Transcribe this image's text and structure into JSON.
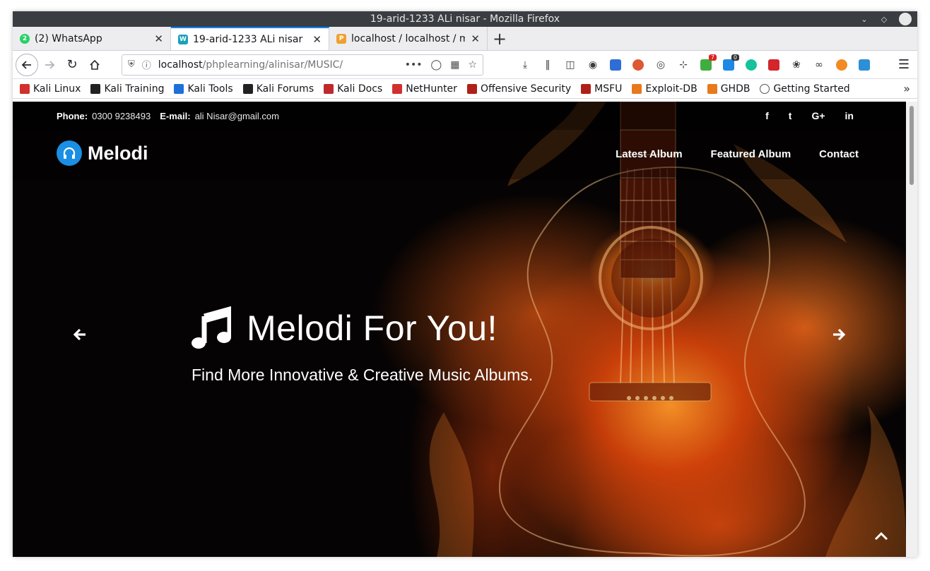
{
  "window": {
    "title": "19-arid-1233 ALi nisar - Mozilla Firefox"
  },
  "tabs": [
    {
      "label": "(2) WhatsApp",
      "icon": "whatsapp-icon",
      "color": "#25d366"
    },
    {
      "label": "19-arid-1233 ALi nisar",
      "icon": "site-icon",
      "color": "#17a2b8"
    },
    {
      "label": "localhost / localhost / mu",
      "icon": "phpmyadmin-icon",
      "color": "#f0a030"
    }
  ],
  "urlbar": {
    "host": "localhost",
    "path": "/phplearning/alinisar/MUSIC/"
  },
  "bookmarks": [
    {
      "label": "Kali Linux",
      "color": "#d0312d"
    },
    {
      "label": "Kali Training",
      "color": "#222222"
    },
    {
      "label": "Kali Tools",
      "color": "#1e6fd9"
    },
    {
      "label": "Kali Forums",
      "color": "#222222"
    },
    {
      "label": "Kali Docs",
      "color": "#c0282d"
    },
    {
      "label": "NetHunter",
      "color": "#d0312d"
    },
    {
      "label": "Offensive Security",
      "color": "#b0201a"
    },
    {
      "label": "MSFU",
      "color": "#b0201a"
    },
    {
      "label": "Exploit-DB",
      "color": "#e8791c"
    },
    {
      "label": "GHDB",
      "color": "#e8791c"
    },
    {
      "label": "Getting Started",
      "color": "#555555"
    }
  ],
  "toolbar_badges": {
    "red": "7",
    "dark": "0"
  },
  "site": {
    "phone_label": "Phone:",
    "phone": "0300 9238493",
    "email_label": "E-mail:",
    "email": "ali Nisar@gmail.com",
    "social": [
      "f",
      "t",
      "G+",
      "in"
    ],
    "brand": "Melodi",
    "nav": [
      "Latest Album",
      "Featured Album",
      "Contact"
    ],
    "hero_title": "Melodi For You!",
    "hero_subtitle": "Find More Innovative & Creative Music Albums."
  },
  "colors": {
    "accent": "#1a8fe3",
    "tab_active": "#0a84ff"
  }
}
